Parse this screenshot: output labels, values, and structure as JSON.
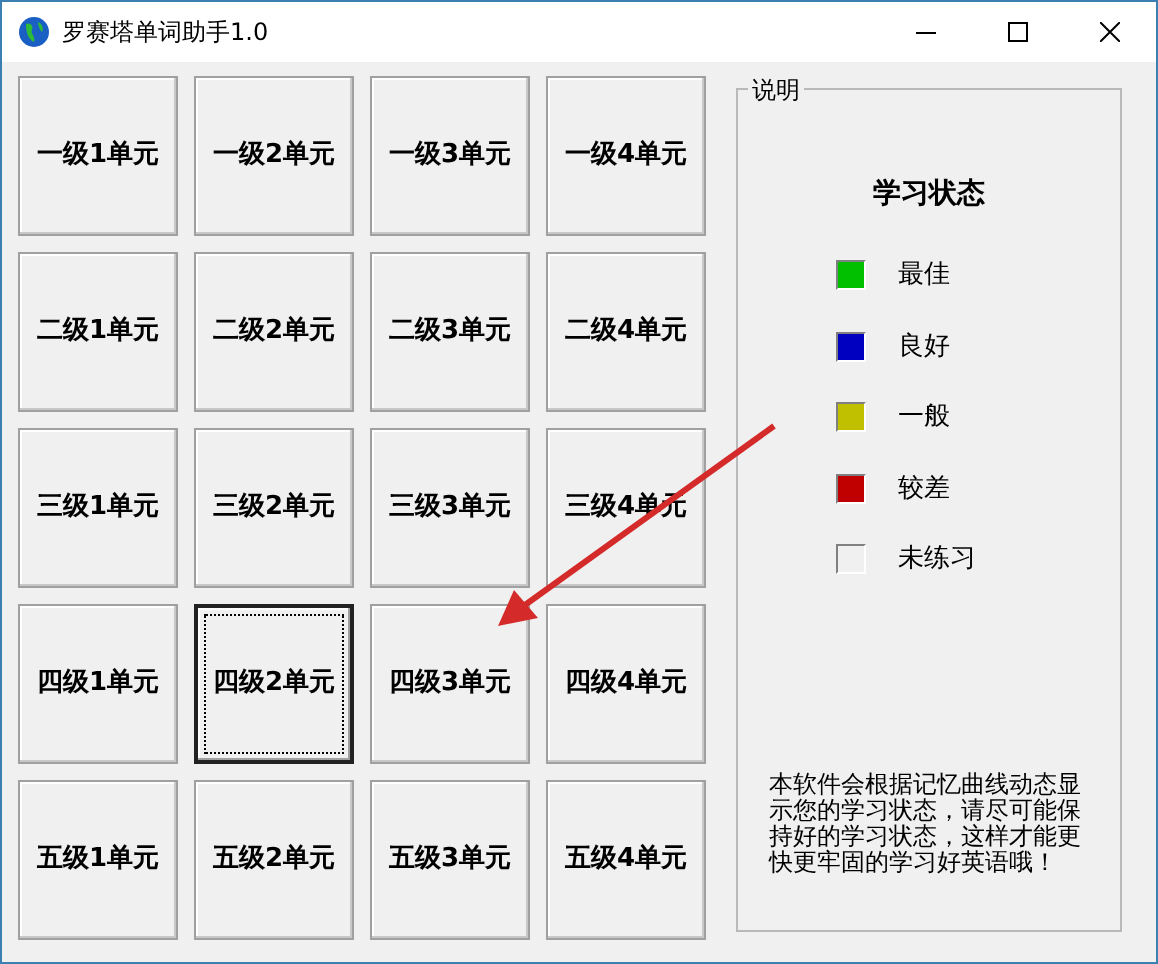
{
  "window": {
    "title": "罗赛塔单词助手1.0"
  },
  "units": [
    {
      "label": "一级1单元",
      "selected": false
    },
    {
      "label": "一级2单元",
      "selected": false
    },
    {
      "label": "一级3单元",
      "selected": false
    },
    {
      "label": "一级4单元",
      "selected": false
    },
    {
      "label": "二级1单元",
      "selected": false
    },
    {
      "label": "二级2单元",
      "selected": false
    },
    {
      "label": "二级3单元",
      "selected": false
    },
    {
      "label": "二级4单元",
      "selected": false
    },
    {
      "label": "三级1单元",
      "selected": false
    },
    {
      "label": "三级2单元",
      "selected": false
    },
    {
      "label": "三级3单元",
      "selected": false
    },
    {
      "label": "三级4单元",
      "selected": false
    },
    {
      "label": "四级1单元",
      "selected": false
    },
    {
      "label": "四级2单元",
      "selected": true
    },
    {
      "label": "四级3单元",
      "selected": false
    },
    {
      "label": "四级4单元",
      "selected": false
    },
    {
      "label": "五级1单元",
      "selected": false
    },
    {
      "label": "五级2单元",
      "selected": false
    },
    {
      "label": "五级3单元",
      "selected": false
    },
    {
      "label": "五级4单元",
      "selected": false
    }
  ],
  "legend": {
    "group_title": "说明",
    "heading": "学习状态",
    "items": [
      {
        "label": "最佳",
        "color": "#00c000"
      },
      {
        "label": "良好",
        "color": "#0000c0"
      },
      {
        "label": "一般",
        "color": "#c0c000"
      },
      {
        "label": "较差",
        "color": "#c00000"
      },
      {
        "label": "未练习",
        "color": "#f0f0f0"
      }
    ],
    "note": "本软件会根据记忆曲线动态显示您的学习状态，请尽可能保持好的学习状态，这样才能更快更牢固的学习好英语哦！"
  }
}
